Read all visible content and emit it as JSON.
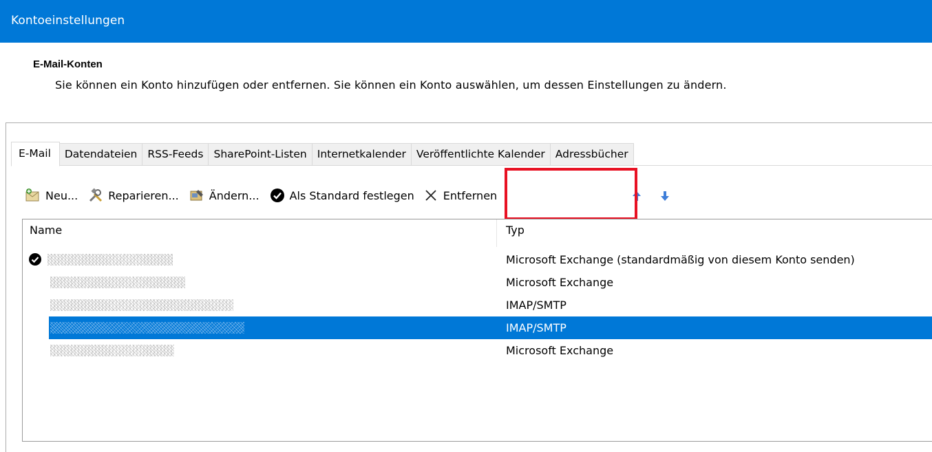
{
  "window": {
    "title": "Kontoeinstellungen"
  },
  "section": {
    "heading": "E-Mail-Konten",
    "description": "Sie können ein Konto hinzufügen oder entfernen. Sie können ein Konto auswählen, um dessen Einstellungen zu ändern."
  },
  "tabs": [
    {
      "label": "E-Mail",
      "active": true
    },
    {
      "label": "Datendateien",
      "active": false
    },
    {
      "label": "RSS-Feeds",
      "active": false
    },
    {
      "label": "SharePoint-Listen",
      "active": false
    },
    {
      "label": "Internetkalender",
      "active": false
    },
    {
      "label": "Veröffentlichte Kalender",
      "active": false
    },
    {
      "label": "Adressbücher",
      "active": false
    }
  ],
  "toolbar": {
    "new_label": "Neu...",
    "repair_label": "Reparieren...",
    "change_label": "Ändern...",
    "default_label": "Als Standard festlegen",
    "remove_label": "Entfernen",
    "icons": {
      "new": "new-mail-account-icon",
      "repair": "tools-icon",
      "change": "change-account-icon",
      "default": "check-circle-icon",
      "remove": "close-x-icon",
      "up": "arrow-up-icon",
      "down": "arrow-down-icon"
    }
  },
  "list": {
    "columns": {
      "name": "Name",
      "type": "Typ"
    },
    "rows": [
      {
        "type": "Microsoft Exchange (standardmäßig von diesem Konto senden)",
        "is_default": true,
        "selected": false
      },
      {
        "type": "Microsoft Exchange",
        "is_default": false,
        "selected": false
      },
      {
        "type": "IMAP/SMTP",
        "is_default": false,
        "selected": false
      },
      {
        "type": "IMAP/SMTP",
        "is_default": false,
        "selected": true
      },
      {
        "type": "Microsoft Exchange",
        "is_default": false,
        "selected": false
      }
    ]
  },
  "colors": {
    "title_bar": "#0078d7",
    "selection": "#0078d7",
    "highlight_box": "#e81123"
  }
}
